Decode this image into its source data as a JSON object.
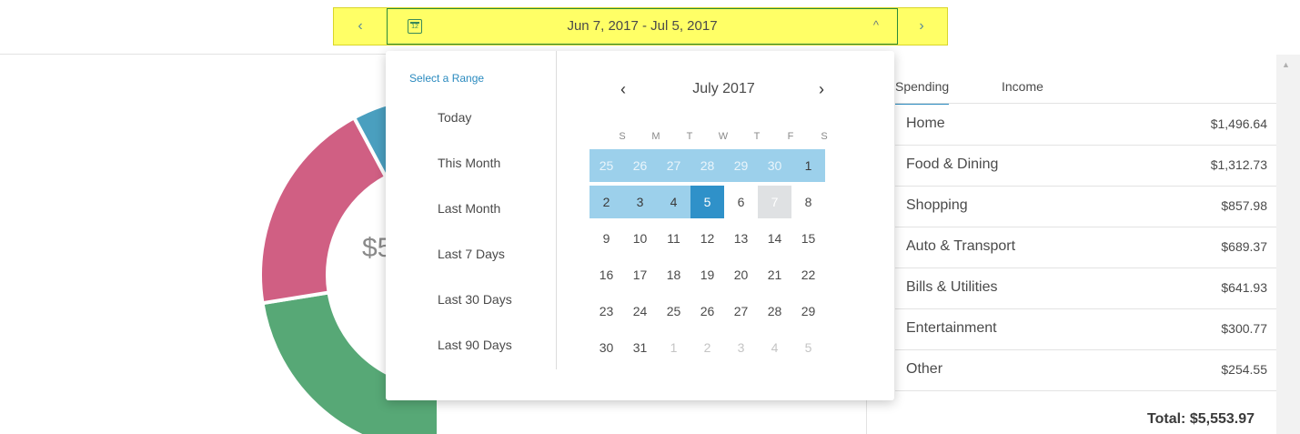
{
  "datebar": {
    "prev_glyph": "‹",
    "next_glyph": "›",
    "calendar_icon_text": "12",
    "range_label": "Jun 7, 2017 - Jul 5, 2017",
    "caret_glyph": "^"
  },
  "donut": {
    "total_partial": "$5",
    "segments": [
      {
        "label": "Home",
        "color": "#57a876",
        "value": 1496.64
      },
      {
        "label": "Food & Dining",
        "color": "#d05f83",
        "value": 1312.73
      },
      {
        "label": "Shopping",
        "color": "#4a9fbf",
        "value": 857.98
      },
      {
        "label": "Auto & Transport",
        "color": "#ee9a2c",
        "value": 689.37
      },
      {
        "label": "Bills & Utilities",
        "color": "#a9578a",
        "value": 641.93
      }
    ]
  },
  "ranges": {
    "title": "Select a Range",
    "items": [
      "Today",
      "This Month",
      "Last Month",
      "Last 7 Days",
      "Last 30 Days",
      "Last 90 Days"
    ]
  },
  "calendar": {
    "prev_glyph": "‹",
    "next_glyph": "›",
    "month": "July 2017",
    "weekdays": [
      "S",
      "M",
      "T",
      "W",
      "T",
      "F",
      "S"
    ],
    "weeks": [
      [
        {
          "d": "25",
          "s": "inrange other"
        },
        {
          "d": "26",
          "s": "inrange other"
        },
        {
          "d": "27",
          "s": "inrange other"
        },
        {
          "d": "28",
          "s": "inrange other"
        },
        {
          "d": "29",
          "s": "inrange other"
        },
        {
          "d": "30",
          "s": "inrange other"
        },
        {
          "d": "1",
          "s": "inrange"
        }
      ],
      [
        {
          "d": "2",
          "s": "inrange"
        },
        {
          "d": "3",
          "s": "inrange"
        },
        {
          "d": "4",
          "s": "inrange"
        },
        {
          "d": "5",
          "s": "selected"
        },
        {
          "d": "6",
          "s": ""
        },
        {
          "d": "7",
          "s": "today"
        },
        {
          "d": "8",
          "s": ""
        }
      ],
      [
        {
          "d": "9",
          "s": ""
        },
        {
          "d": "10",
          "s": ""
        },
        {
          "d": "11",
          "s": ""
        },
        {
          "d": "12",
          "s": ""
        },
        {
          "d": "13",
          "s": ""
        },
        {
          "d": "14",
          "s": ""
        },
        {
          "d": "15",
          "s": ""
        }
      ],
      [
        {
          "d": "16",
          "s": ""
        },
        {
          "d": "17",
          "s": ""
        },
        {
          "d": "18",
          "s": ""
        },
        {
          "d": "19",
          "s": ""
        },
        {
          "d": "20",
          "s": ""
        },
        {
          "d": "21",
          "s": ""
        },
        {
          "d": "22",
          "s": ""
        }
      ],
      [
        {
          "d": "23",
          "s": ""
        },
        {
          "d": "24",
          "s": ""
        },
        {
          "d": "25",
          "s": ""
        },
        {
          "d": "26",
          "s": ""
        },
        {
          "d": "27",
          "s": ""
        },
        {
          "d": "28",
          "s": ""
        },
        {
          "d": "29",
          "s": ""
        }
      ],
      [
        {
          "d": "30",
          "s": ""
        },
        {
          "d": "31",
          "s": ""
        },
        {
          "d": "1",
          "s": "other"
        },
        {
          "d": "2",
          "s": "other"
        },
        {
          "d": "3",
          "s": "other"
        },
        {
          "d": "4",
          "s": "other"
        },
        {
          "d": "5",
          "s": "other"
        }
      ]
    ]
  },
  "tabs": [
    "Spending",
    "Income"
  ],
  "active_tab": "Spending",
  "categories": [
    {
      "name": "Home",
      "amount": "$1,496.64"
    },
    {
      "name": "Food & Dining",
      "amount": "$1,312.73"
    },
    {
      "name": "Shopping",
      "amount": "$857.98"
    },
    {
      "name": "Auto & Transport",
      "amount": "$689.37"
    },
    {
      "name": "Bills & Utilities",
      "amount": "$641.93"
    },
    {
      "name": "Entertainment",
      "amount": "$300.77"
    },
    {
      "name": "Other",
      "amount": "$254.55"
    }
  ],
  "total": "Total: $5,553.97",
  "colors": {
    "accent": "#2a8abf",
    "range_fill": "#9cd0eb",
    "selected": "#2f91c9",
    "highlight": "#ffff66"
  }
}
